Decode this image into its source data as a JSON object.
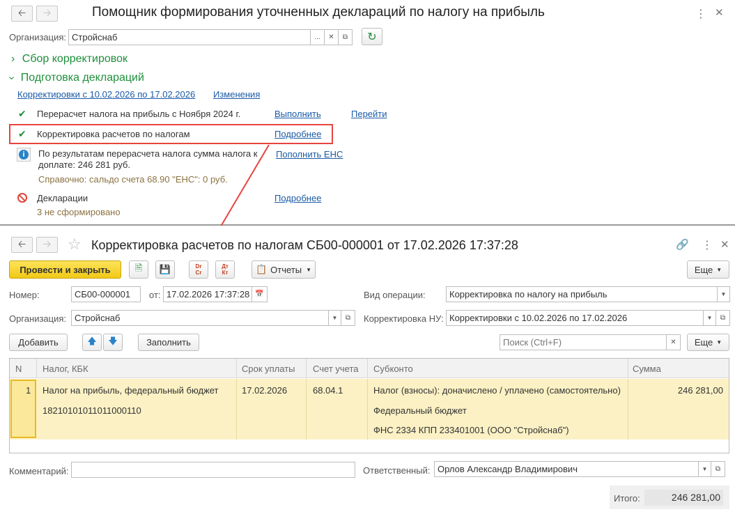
{
  "wizard": {
    "title": "Помощник формирования уточненных деклараций по налогу на прибыль",
    "org_label": "Организация:",
    "org_value": "Стройснаб",
    "section_collect": "Сбор корректировок",
    "section_prepare": "Подготовка деклараций",
    "period_link": "Корректировки с 10.02.2026 по 17.02.2026",
    "changes_link": "Изменения",
    "steps": [
      {
        "text": "Перерасчет налога на прибыль с Ноября 2024 г.",
        "link1": "Выполнить",
        "link2": "Перейти"
      },
      {
        "text": "Корректировка расчетов по налогам",
        "link1": "Подробнее"
      }
    ],
    "info_text_1": "По результатам перерасчета налога сумма налога к",
    "info_text_2": "доплате: 246 281 руб.",
    "info_link": "Пополнить ЕНС",
    "info_note": "Справочно: сальдо счета 68.90 \"ЕНС\": 0 руб.",
    "decl_text": "Декларации",
    "decl_link": "Подробнее",
    "decl_status": "3 не сформировано"
  },
  "doc": {
    "title": "Корректировка расчетов по налогам СБ00-000001 от 17.02.2026 17:37:28",
    "post_close": "Провести и закрыть",
    "reports": "Отчеты",
    "more": "Еще",
    "number_label": "Номер:",
    "number_value": "СБ00-000001",
    "from_label": "от:",
    "date_value": "17.02.2026 17:37:28",
    "op_label": "Вид операции:",
    "op_value": "Корректировка по налогу на прибыль",
    "org_label": "Организация:",
    "org_value": "Стройснаб",
    "corr_label": "Корректировка НУ:",
    "corr_value": "Корректировки с 10.02.2026 по 17.02.2026",
    "add": "Добавить",
    "fill": "Заполнить",
    "search_placeholder": "Поиск (Ctrl+F)",
    "more2": "Еще",
    "columns": [
      "N",
      "Налог, КБК",
      "Срок уплаты",
      "Счет учета",
      "Субконто",
      "Сумма"
    ],
    "row": {
      "n": "1",
      "tax": "Налог на прибыль, федеральный бюджет",
      "kbk": "18210101011011000110",
      "due": "17.02.2026",
      "account": "68.04.1",
      "sub1": "Налог (взносы): доначислено / уплачено (самостоятельно)",
      "sub2": "Федеральный бюджет",
      "sub3": "ФНС 2334 КПП 233401001 (ООО \"Стройснаб\")",
      "sum": "246 281,00"
    },
    "comment_label": "Комментарий:",
    "resp_label": "Ответственный:",
    "resp_value": "Орлов Александр Владимирович",
    "total_label": "Итого:",
    "total_value": "246 281,00"
  },
  "colors": {
    "accent_green": "#1d8f3a",
    "link": "#1a5aa6",
    "highlight": "#e8433f",
    "post_button": "#f6d42a",
    "selected_row": "#fbf1c4"
  }
}
